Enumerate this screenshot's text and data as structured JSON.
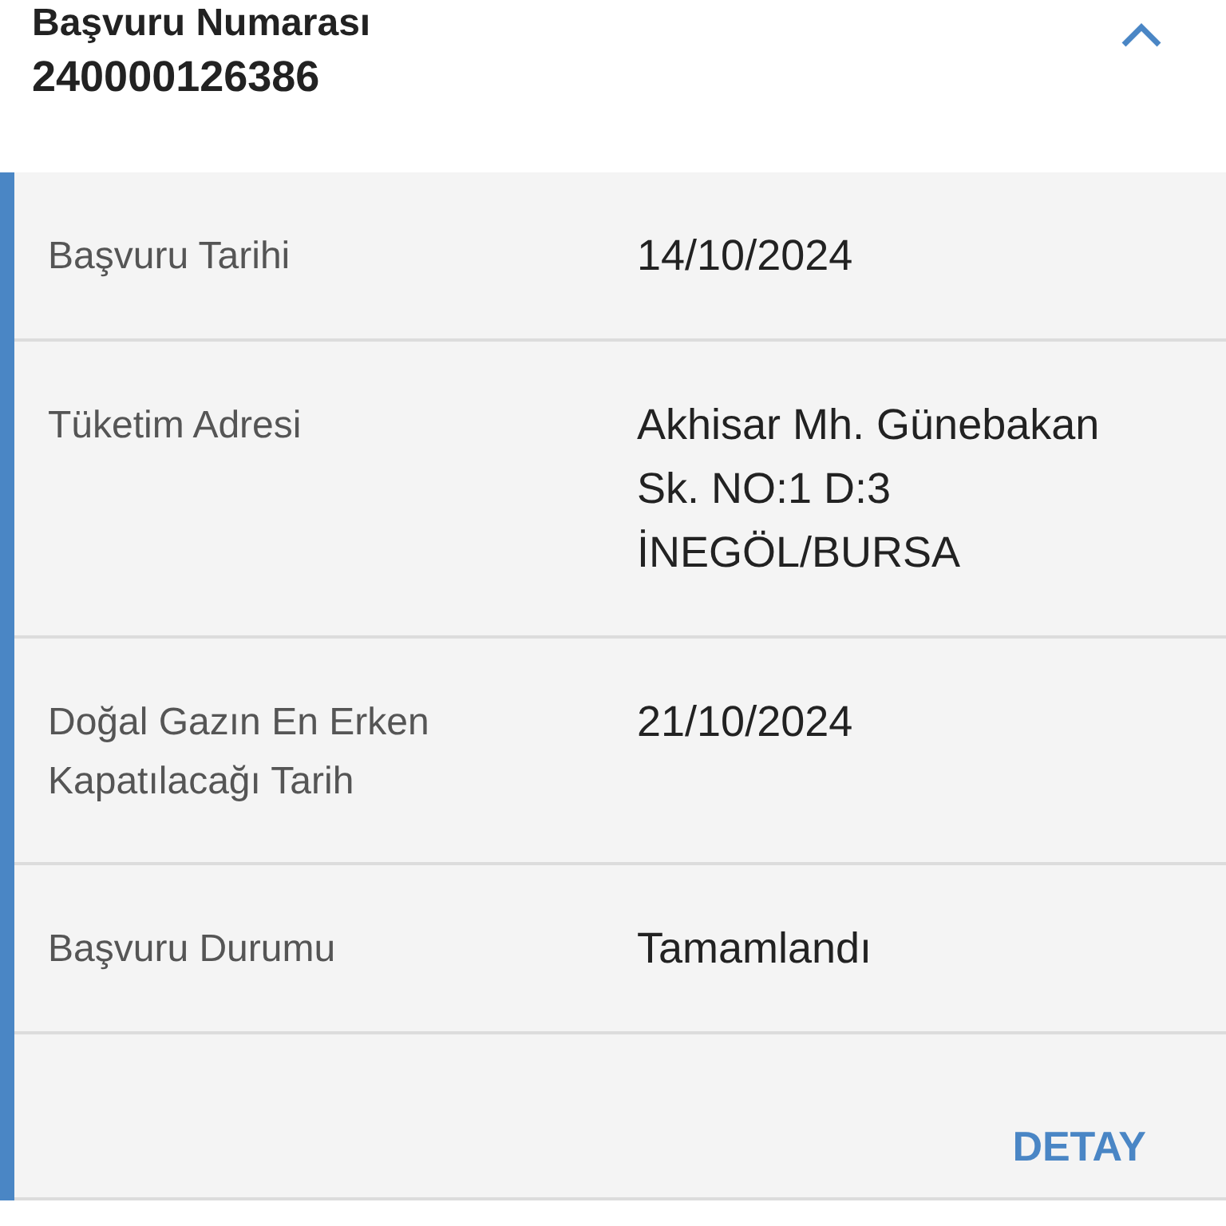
{
  "header": {
    "title": "Başvuru Numarası",
    "number": "240000126386",
    "expanded": true
  },
  "details": [
    {
      "label": "Başvuru Tarihi",
      "value": "14/10/2024"
    },
    {
      "label": "Tüketim Adresi",
      "value": "Akhisar Mh. Günebakan Sk. NO:1 D:3 İNEGÖL/BURSA"
    },
    {
      "label": "Doğal Gazın En Erken Kapatılacağı Tarih",
      "value": "21/10/2024"
    },
    {
      "label": "Başvuru Durumu",
      "value": "Tamamlandı"
    }
  ],
  "button": "DETAY"
}
